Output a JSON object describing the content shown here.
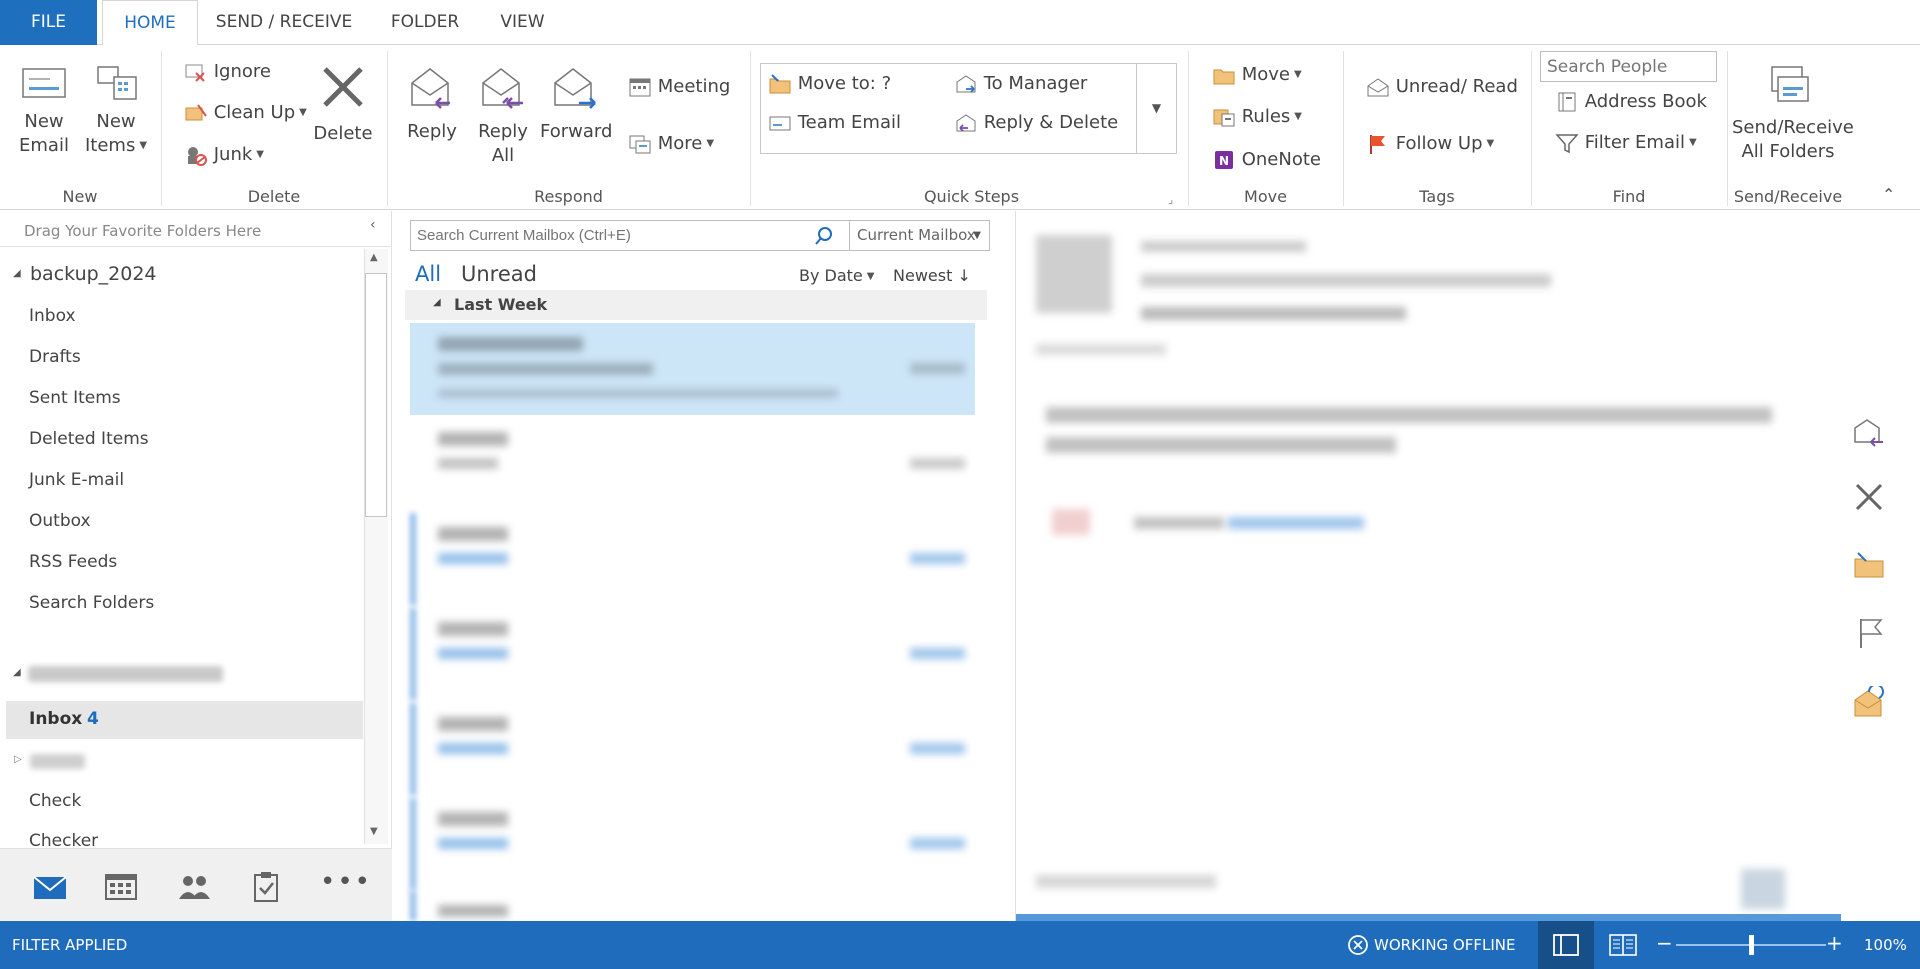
{
  "tabs": {
    "file": "FILE",
    "home": "HOME",
    "send_receive": "SEND / RECEIVE",
    "folder": "FOLDER",
    "view": "VIEW"
  },
  "ribbon": {
    "new": {
      "new_email_l1": "New",
      "new_email_l2": "Email",
      "new_items_l1": "New",
      "new_items_l2": "Items",
      "group_label": "New"
    },
    "delete": {
      "ignore": "Ignore",
      "clean_up": "Clean Up",
      "junk": "Junk",
      "delete": "Delete",
      "group_label": "Delete"
    },
    "respond": {
      "reply": "Reply",
      "reply_all_l1": "Reply",
      "reply_all_l2": "All",
      "forward": "Forward",
      "meeting": "Meeting",
      "more": "More",
      "group_label": "Respond"
    },
    "quick_steps": {
      "move_to": "Move to: ?",
      "to_manager": "To Manager",
      "team_email": "Team Email",
      "reply_delete": "Reply & Delete",
      "group_label": "Quick Steps"
    },
    "move": {
      "move": "Move",
      "rules": "Rules",
      "onenote": "OneNote",
      "group_label": "Move"
    },
    "tags": {
      "unread_read": "Unread/ Read",
      "follow_up": "Follow Up",
      "group_label": "Tags"
    },
    "find": {
      "search_people_placeholder": "Search People",
      "address_book": "Address Book",
      "filter_email": "Filter Email",
      "group_label": "Find"
    },
    "send_receive": {
      "label_l1": "Send/Receive",
      "label_l2": "All Folders",
      "group_label": "Send/Receive"
    }
  },
  "nav": {
    "favorites_hint": "Drag Your Favorite Folders Here",
    "account1": "backup_2024",
    "folders1": [
      "Inbox",
      "Drafts",
      "Sent Items",
      "Deleted Items",
      "Junk E-mail",
      "Outbox",
      "RSS Feeds",
      "Search Folders"
    ],
    "inbox2": "Inbox",
    "inbox2_count": "4",
    "check": "Check",
    "checker": "Checker"
  },
  "maillist": {
    "search_placeholder": "Search Current Mailbox (Ctrl+E)",
    "mailbox_scope": "Current Mailbox",
    "filter_all": "All",
    "filter_unread": "Unread",
    "sort_by": "By Date",
    "sort_order": "Newest",
    "group_header": "Last Week"
  },
  "statusbar": {
    "filter": "FILTER APPLIED",
    "offline": "WORKING OFFLINE",
    "zoom": "100%"
  },
  "zoom_level": 0.5,
  "colors": {
    "accent": "#1e6cbb",
    "file_tab": "#1f6fbf",
    "selected_row": "#cde6f7",
    "unread_bar": "#8ab8e6",
    "link": "#2a7fd4"
  }
}
